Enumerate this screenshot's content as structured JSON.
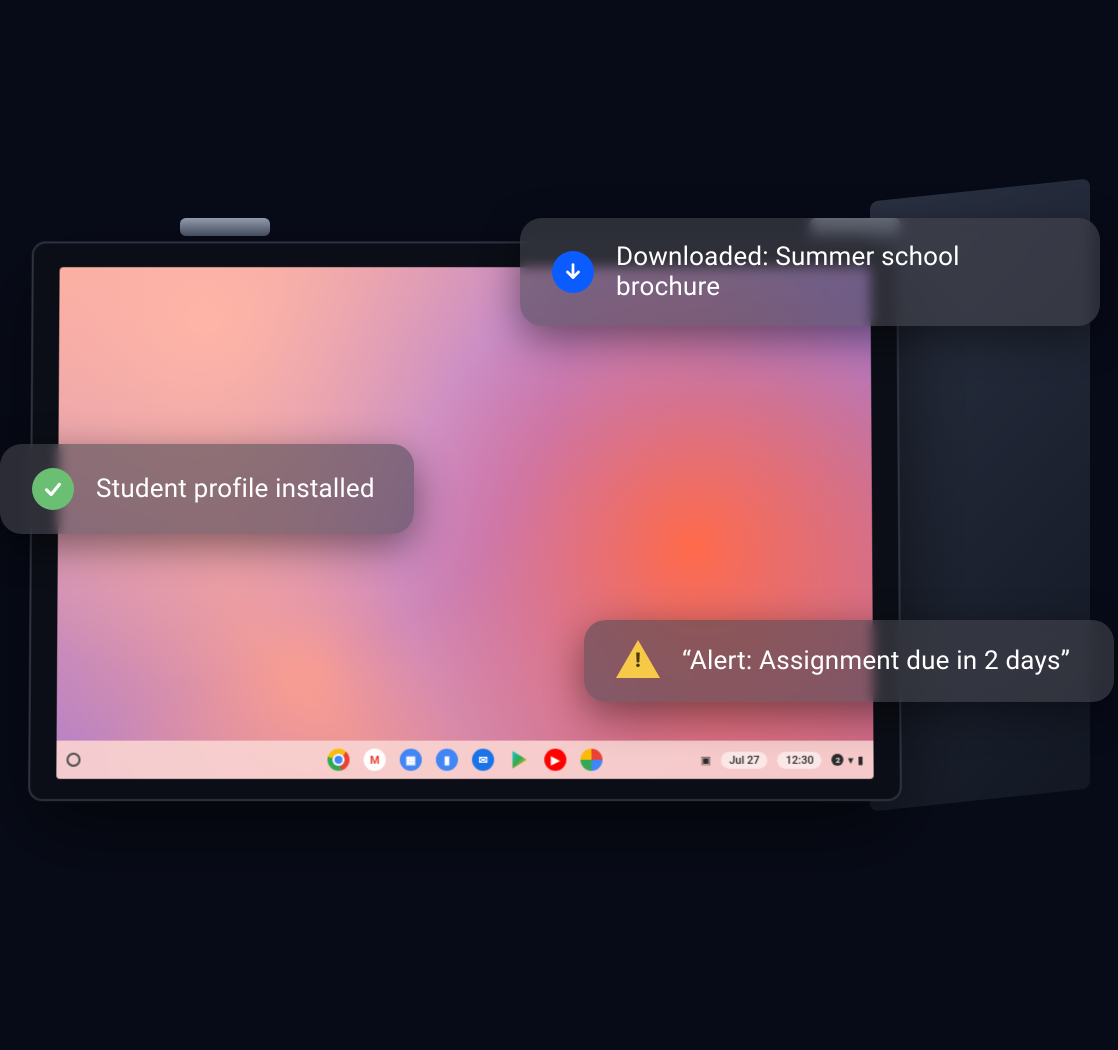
{
  "notifications": {
    "download": {
      "icon": "download-arrow-icon",
      "text": "Downloaded: Summer school brochure",
      "badge_color": "#0b5cff"
    },
    "profile": {
      "icon": "checkmark-icon",
      "text": "Student profile installed",
      "badge_color": "#6bbf73"
    },
    "alert": {
      "icon": "warning-icon",
      "text": "“Alert: Assignment due in 2 days”",
      "badge_color": "#f7c948"
    }
  },
  "taskbar": {
    "apps": [
      {
        "name": "chrome-icon",
        "label": "Chrome"
      },
      {
        "name": "gmail-icon",
        "label": "Gmail"
      },
      {
        "name": "calendar-icon",
        "label": "Calendar"
      },
      {
        "name": "files-icon",
        "label": "Files"
      },
      {
        "name": "messages-icon",
        "label": "Messages"
      },
      {
        "name": "play-icon",
        "label": "Play Store"
      },
      {
        "name": "youtube-icon",
        "label": "YouTube"
      },
      {
        "name": "photos-icon",
        "label": "Photos"
      }
    ],
    "date": "Jul 27",
    "time": "12:30",
    "status_badge": "2",
    "indicators": {
      "wifi": true,
      "battery": true
    }
  }
}
